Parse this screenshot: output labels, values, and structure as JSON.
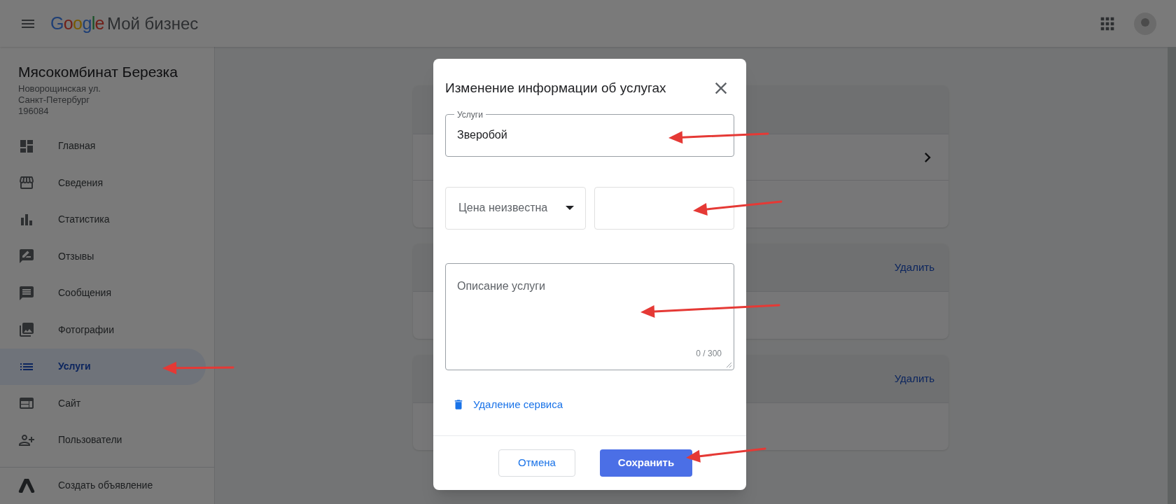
{
  "header": {
    "logo": "Google",
    "product": "Мой бизнес"
  },
  "business": {
    "name": "Мясокомбинат Березка",
    "address_lines": [
      "Новорощинская ул.",
      "Санкт-Петербург",
      "196084"
    ]
  },
  "nav": [
    {
      "label": "Главная",
      "selected": false
    },
    {
      "label": "Сведения",
      "selected": false
    },
    {
      "label": "Статистика",
      "selected": false
    },
    {
      "label": "Отзывы",
      "selected": false
    },
    {
      "label": "Сообщения",
      "selected": false
    },
    {
      "label": "Фотографии",
      "selected": false
    },
    {
      "label": "Услуги",
      "selected": true
    },
    {
      "label": "Сайт",
      "selected": false
    },
    {
      "label": "Пользователи",
      "selected": false
    }
  ],
  "nav_footer": {
    "label": "Создать объявление"
  },
  "cards": [
    {
      "kind": "chevron"
    },
    {
      "kind": "deletable",
      "action": "Удалить"
    },
    {
      "kind": "deletable",
      "action": "Удалить"
    }
  ],
  "dialog": {
    "title": "Изменение информации об услугах",
    "service_field": {
      "label": "Услуги",
      "value": "Зверобой"
    },
    "price_select": {
      "value": "Цена неизвестна"
    },
    "description": {
      "placeholder": "Описание услуги",
      "counter": "0 / 300"
    },
    "delete_link": "Удаление сервиса",
    "buttons": [
      {
        "label": "Отмена",
        "kind": "secondary"
      },
      {
        "label": "Сохранить",
        "kind": "primary"
      }
    ]
  }
}
